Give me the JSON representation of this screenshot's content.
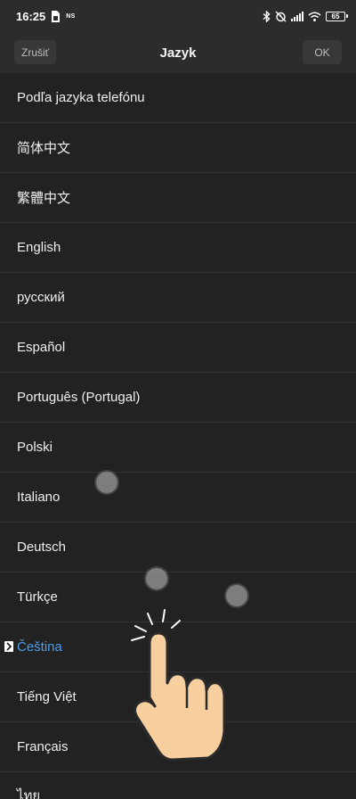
{
  "status_bar": {
    "time": "16:25",
    "ns_label": "NS",
    "battery": "65"
  },
  "header": {
    "title": "Jazyk",
    "cancel_label": "Zrušiť",
    "ok_label": "OK"
  },
  "languages": [
    "Podľa jazyka telefónu",
    "简体中文",
    "繁體中文",
    "English",
    "русский",
    "Español",
    "Português (Portugal)",
    "Polski",
    "Italiano",
    "Deutsch",
    "Türkçe",
    "Čeština",
    "Tiếng Việt",
    "Français",
    "ไทย"
  ],
  "selected_index": 11,
  "colors": {
    "background": "#222222",
    "header": "#2c2c2c",
    "selected_text": "#4a9eed",
    "divider": "#333333"
  }
}
